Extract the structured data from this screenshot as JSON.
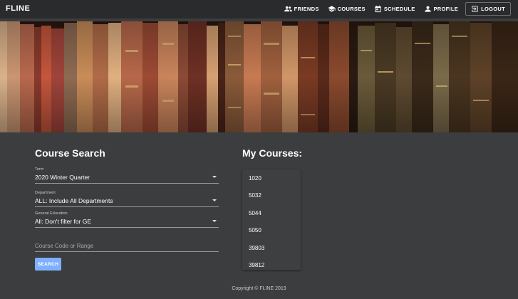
{
  "app": {
    "brand": "FLINE"
  },
  "nav": {
    "friends": "FRIENDS",
    "courses": "COURSES",
    "schedule": "SCHEDULE",
    "profile": "PROFILE",
    "logout": "LOGOUT"
  },
  "search": {
    "title": "Course Search",
    "term_label": "Term",
    "term_value": "2020 Winter Quarter",
    "department_label": "Department",
    "department_value": "ALL: Include All Departments",
    "ge_label": "General Education",
    "ge_value": "All: Don't filter for GE",
    "code_placeholder": "Course Code or Range",
    "button": "SEARCH"
  },
  "my_courses": {
    "title": "My Courses:",
    "items": [
      "1020",
      "5032",
      "5044",
      "5050",
      "39803",
      "39812"
    ]
  },
  "footer": {
    "copyright": "Copyright © FLINE 2019"
  },
  "icons": {
    "friends": "people-icon",
    "courses": "graduation-cap-icon",
    "schedule": "calendar-icon",
    "profile": "person-icon",
    "logout": "exit-icon"
  }
}
